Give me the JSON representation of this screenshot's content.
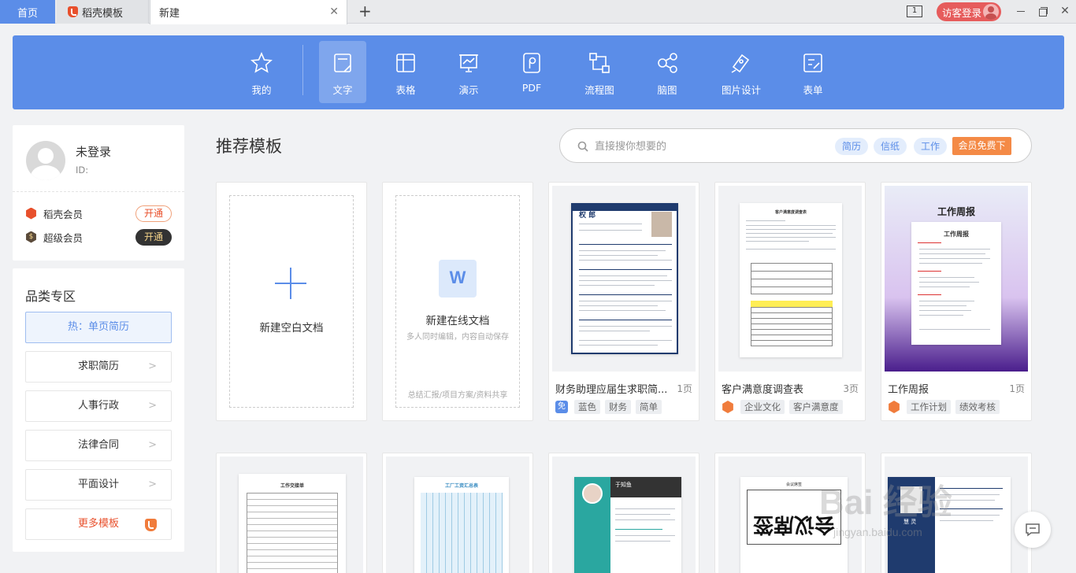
{
  "tabs": {
    "home": "首页",
    "daoke": "稻壳模板",
    "new": "新建"
  },
  "window": {
    "visitor_login": "访客登录",
    "dual_screen_icon": "1"
  },
  "ribbon": [
    {
      "label": "我的",
      "icon": "star-icon"
    },
    {
      "label": "文字",
      "icon": "document-icon"
    },
    {
      "label": "表格",
      "icon": "table-icon"
    },
    {
      "label": "演示",
      "icon": "presentation-icon"
    },
    {
      "label": "PDF",
      "icon": "pdf-icon"
    },
    {
      "label": "流程图",
      "icon": "flowchart-icon"
    },
    {
      "label": "脑图",
      "icon": "mindmap-icon"
    },
    {
      "label": "图片设计",
      "icon": "image-design-icon"
    },
    {
      "label": "表单",
      "icon": "form-icon"
    }
  ],
  "user": {
    "name": "未登录",
    "id_label": "ID:",
    "daoke_member": "稻壳会员",
    "daoke_open": "开通",
    "super_member": "超级会员",
    "super_open": "开通",
    "super_icon_text": "$"
  },
  "categories": {
    "title": "品类专区",
    "hot": "热：单页简历",
    "items": [
      "求职简历",
      "人事行政",
      "法律合同",
      "平面设计"
    ],
    "more": "更多模板"
  },
  "main": {
    "title": "推荐模板",
    "search_placeholder": "直接搜你想要的",
    "hot_tags": [
      "简历",
      "信纸",
      "工作"
    ],
    "vip_free": "会员免费下"
  },
  "blank_doc": {
    "label": "新建空白文档"
  },
  "online_doc": {
    "icon_text": "W",
    "label": "新建在线文档",
    "subtitle": "多人同时编辑，内容自动保存",
    "footer": "总结汇报/项目方案/资料共享"
  },
  "templates": [
    {
      "title": "财务助理应届生求职简...",
      "pages": "1页",
      "badge": "免",
      "tags": [
        "蓝色",
        "财务",
        "简单"
      ]
    },
    {
      "title": "客户满意度调查表",
      "pages": "3页",
      "badge": "",
      "tags": [
        "企业文化",
        "客户满意度"
      ]
    },
    {
      "title": "工作周报",
      "pages": "1页",
      "badge": "",
      "tags": [
        "工作计划",
        "绩效考核"
      ]
    }
  ],
  "thumb_texts": {
    "resume_name": "权 郎",
    "survey_title": "客户满意度调查表",
    "weekly_cover": "工作周报",
    "weekly_inner": "工作周报",
    "row2_1": "工作交接单",
    "row2_2": "工厂工资汇总表",
    "row2_3": "于知鱼",
    "row2_4": "会议席签",
    "row2_4_big": "会议席签",
    "row2_5": "慧 灵"
  },
  "watermark": {
    "main": "Bai 经验",
    "sub": "jingyan.baidu.com"
  },
  "colors": {
    "accent": "#5b8de8",
    "orange": "#f48a46",
    "daoke_red": "#e8502c",
    "red_login": "#e65c5c"
  }
}
